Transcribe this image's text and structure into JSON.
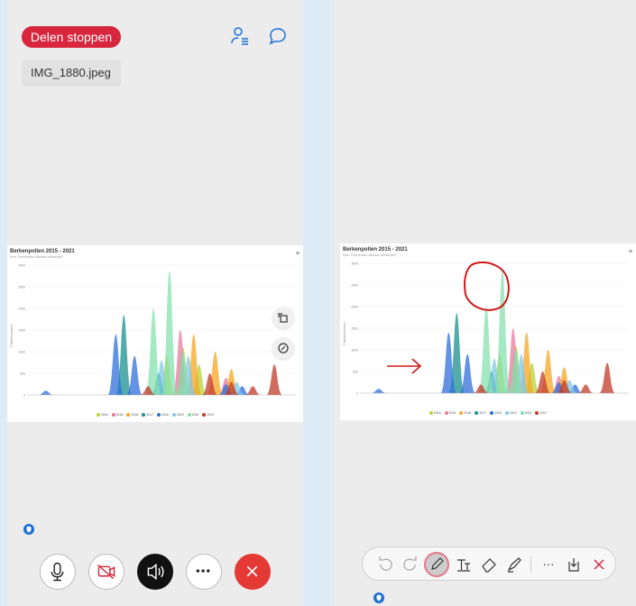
{
  "left_panel": {
    "stop_sharing_label": "Delen stoppen",
    "file_name": "IMG_1880.jpeg",
    "icons": [
      "participants-icon",
      "chat-icon",
      "rotate-icon",
      "annotate-icon",
      "mic-icon",
      "video-off-icon",
      "speaker-icon",
      "more-icon",
      "end-call-icon",
      "shield-icon"
    ]
  },
  "right_panel": {
    "toolbar_icons": [
      "undo-icon",
      "redo-icon",
      "pen-icon",
      "text-icon",
      "eraser-icon",
      "highlighter-icon",
      "more-icon",
      "save-icon",
      "close-icon"
    ],
    "more_label": "···"
  },
  "colors": {
    "stop_red": "#d7263d",
    "end_call_red": "#e53935",
    "accent_blue": "#1d6fd6",
    "annotation_red": "#d01818"
  },
  "chart_data": {
    "type": "area",
    "title": "Berkenpollen 2015 - 2021",
    "subtitle": "bron: Pollenmeen Allerdan Antwerpen",
    "ylabel": "Pollenkorrels/m³",
    "y_ticks": [
      "3000",
      "2500",
      "2000",
      "1500",
      "1000",
      "500",
      "0"
    ],
    "ylim": [
      0,
      3000
    ],
    "legend": [
      {
        "name": "2015",
        "color": "#b7d334"
      },
      {
        "name": "2016",
        "color": "#e57aa0"
      },
      {
        "name": "2016",
        "color": "#f5a623"
      },
      {
        "name": "2017",
        "color": "#1a8f8f"
      },
      {
        "name": "2018",
        "color": "#2f6fd8"
      },
      {
        "name": "2019",
        "color": "#7fc8e8"
      },
      {
        "name": "2020",
        "color": "#86e0b0"
      },
      {
        "name": "2021",
        "color": "#c0392b"
      }
    ],
    "series": [
      {
        "name": "2015",
        "color": "#b7d334",
        "peaks": [
          [
            0.52,
            900
          ],
          [
            0.58,
            1100
          ],
          [
            0.64,
            700
          ]
        ]
      },
      {
        "name": "2016",
        "color": "#e57aa0",
        "peaks": [
          [
            0.57,
            1500
          ],
          [
            0.74,
            400
          ]
        ]
      },
      {
        "name": "2016",
        "color": "#f5a623",
        "peaks": [
          [
            0.62,
            1400
          ],
          [
            0.7,
            1000
          ],
          [
            0.76,
            600
          ]
        ]
      },
      {
        "name": "2017",
        "color": "#1a8f8f",
        "peaks": [
          [
            0.36,
            1850
          ],
          [
            0.49,
            500
          ]
        ]
      },
      {
        "name": "2018",
        "color": "#2f6fd8",
        "peaks": [
          [
            0.07,
            100
          ],
          [
            0.33,
            1400
          ],
          [
            0.4,
            900
          ],
          [
            0.74,
            250
          ],
          [
            0.8,
            200
          ]
        ]
      },
      {
        "name": "2019",
        "color": "#7fc8e8",
        "peaks": [
          [
            0.5,
            800
          ],
          [
            0.6,
            900
          ],
          [
            0.78,
            300
          ]
        ]
      },
      {
        "name": "2020",
        "color": "#86e0b0",
        "peaks": [
          [
            0.47,
            2000
          ],
          [
            0.53,
            2850
          ],
          [
            0.58,
            1000
          ]
        ]
      },
      {
        "name": "2021",
        "color": "#c0392b",
        "peaks": [
          [
            0.45,
            200
          ],
          [
            0.68,
            500
          ],
          [
            0.76,
            300
          ],
          [
            0.84,
            200
          ],
          [
            0.92,
            700
          ]
        ]
      }
    ]
  }
}
